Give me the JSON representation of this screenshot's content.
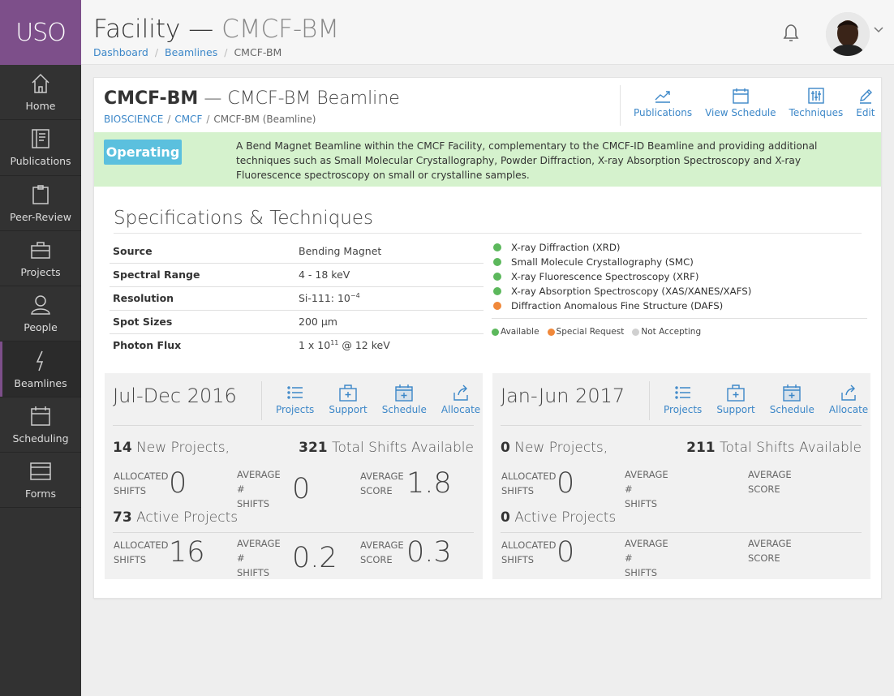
{
  "app": {
    "logo": "USO"
  },
  "sidebar": {
    "items": [
      {
        "label": "Home",
        "icon": "home-icon"
      },
      {
        "label": "Publications",
        "icon": "book-icon"
      },
      {
        "label": "Peer-Review",
        "icon": "clipboard-icon"
      },
      {
        "label": "Projects",
        "icon": "briefcase-icon"
      },
      {
        "label": "People",
        "icon": "person-icon"
      },
      {
        "label": "Beamlines",
        "icon": "bolt-icon",
        "active": true
      },
      {
        "label": "Scheduling",
        "icon": "calendar-icon"
      },
      {
        "label": "Forms",
        "icon": "forms-icon"
      }
    ]
  },
  "header": {
    "title": "Facility",
    "title_sep": "—",
    "subtitle": "CMCF-BM",
    "breadcrumbs": [
      "Dashboard",
      "Beamlines",
      "CMCF-BM"
    ]
  },
  "beamline": {
    "code": "CMCF-BM",
    "dash": "—",
    "name": "CMCF-BM Beamline",
    "crumbs": [
      "BIOSCIENCE",
      "CMCF",
      "CMCF-BM (Beamline)"
    ],
    "actions": [
      {
        "label": "Publications",
        "icon": "chart-icon"
      },
      {
        "label": "View Schedule",
        "icon": "calendar-icon"
      },
      {
        "label": "Techniques",
        "icon": "sliders-icon"
      },
      {
        "label": "Edit",
        "icon": "pencil-icon"
      }
    ],
    "status": "Operating",
    "status_color": "#5bc0de",
    "description": "A Bend Magnet Beamline within the CMCF Facility, complementary to the CMCF-ID Beamline and providing additional techniques such as Small Molecular Crystallography, Powder Diffraction, X-ray Absorption Spectroscopy and X-ray Fluorescence spectroscopy on small or crystalline samples."
  },
  "specs": {
    "title": "Specifications & Techniques",
    "rows": [
      {
        "key": "Source",
        "value": "Bending Magnet"
      },
      {
        "key": "Spectral Range",
        "value": "4 - 18 keV"
      },
      {
        "key": "Resolution",
        "value": "Si-111: 10",
        "sup": "−4",
        "after": ""
      },
      {
        "key": "Spot Sizes",
        "value": "200 µm"
      },
      {
        "key": "Photon Flux",
        "value": "1 x 10",
        "sup": "11",
        "after": " @ 12 keV"
      }
    ],
    "techniques": [
      {
        "name": "X-ray Diffraction (XRD)",
        "status": "available"
      },
      {
        "name": "Small Molecule Crystallography (SMC)",
        "status": "available"
      },
      {
        "name": "X-ray Fluorescence Spectroscopy (XRF)",
        "status": "available"
      },
      {
        "name": "X-ray Absorption Spectroscopy (XAS/XANES/XAFS)",
        "status": "available"
      },
      {
        "name": "Diffraction Anomalous Fine Structure (DAFS)",
        "status": "special"
      }
    ],
    "legend": [
      {
        "label": "Available",
        "color": "#5cb85c"
      },
      {
        "label": "Special Request",
        "color": "#f0883a"
      },
      {
        "label": "Not Accepting",
        "color": "#d0d0d0"
      }
    ]
  },
  "cycles": [
    {
      "name": "Jul-Dec 2016",
      "actions": [
        "Projects",
        "Support",
        "Schedule",
        "Allocate"
      ],
      "new_count": "14",
      "new_label": "New Projects,",
      "shifts_count": "321",
      "shifts_label": "Total Shifts Available",
      "new_stats": {
        "allocated": "0",
        "average": "0",
        "score": "1.8"
      },
      "active_count": "73",
      "active_label": "Active Projects",
      "active_stats": {
        "allocated": "16",
        "average": "0.2",
        "score": "0.3"
      }
    },
    {
      "name": "Jan-Jun 2017",
      "actions": [
        "Projects",
        "Support",
        "Schedule",
        "Allocate"
      ],
      "new_count": "0",
      "new_label": "New Projects,",
      "shifts_count": "211",
      "shifts_label": "Total Shifts Available",
      "new_stats": {
        "allocated": "0",
        "average": "",
        "score": ""
      },
      "active_count": "0",
      "active_label": "Active Projects",
      "active_stats": {
        "allocated": "0",
        "average": "",
        "score": ""
      }
    }
  ],
  "stat_labels": {
    "allocated_1": "ALLOCATED",
    "allocated_2": "SHIFTS",
    "average_1": "AVERAGE #",
    "average_2": "SHIFTS",
    "score_1": "AVERAGE",
    "score_2": "SCORE"
  },
  "colors": {
    "accent": "#7d4f8a",
    "link": "#3c87c8",
    "available": "#5cb85c",
    "special": "#f0883a"
  }
}
